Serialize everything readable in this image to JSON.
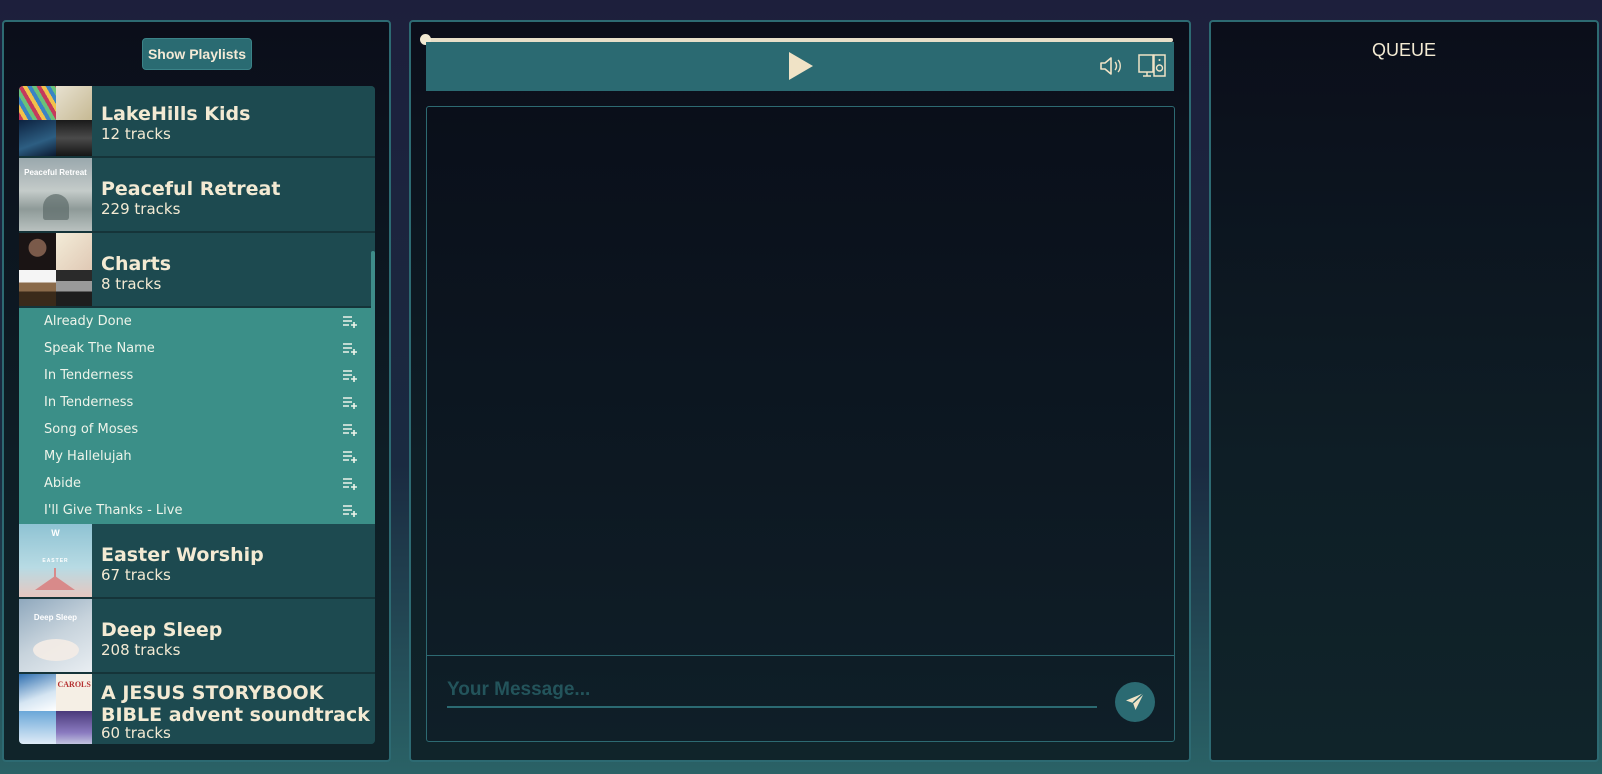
{
  "sidebar": {
    "show_playlists_label": "Show Playlists",
    "playlists": [
      {
        "name": "LakeHills Kids",
        "count": "12 tracks"
      },
      {
        "name": "Peaceful Retreat",
        "count": "229 tracks",
        "cover_text": "Peaceful Retreat"
      },
      {
        "name": "Charts",
        "count": "8 tracks"
      },
      {
        "name": "Easter Worship",
        "count": "67 tracks",
        "cover_text": "EASTER"
      },
      {
        "name": "Deep Sleep",
        "count": "208 tracks",
        "cover_text": "Deep Sleep"
      },
      {
        "name": "A JESUS STORYBOOK BIBLE advent soundtrack",
        "count": "60 tracks",
        "cover_text": "CAROLS"
      }
    ],
    "expanded_tracks": [
      "Already Done",
      "Speak The Name",
      "In Tenderness",
      "In Tenderness",
      "Song of Moses",
      "My Hallelujah",
      "Abide",
      "I'll Give Thanks - Live"
    ]
  },
  "player": {
    "progress": 0,
    "icons": [
      "play-icon",
      "volume-icon",
      "devices-icon"
    ]
  },
  "chat": {
    "placeholder": "Your Message...",
    "send_icon": "send-icon"
  },
  "queue": {
    "title": "QUEUE"
  },
  "colors": {
    "accent": "#2b6a72",
    "track_highlight": "#3b8f88",
    "text": "#f3ead3"
  }
}
